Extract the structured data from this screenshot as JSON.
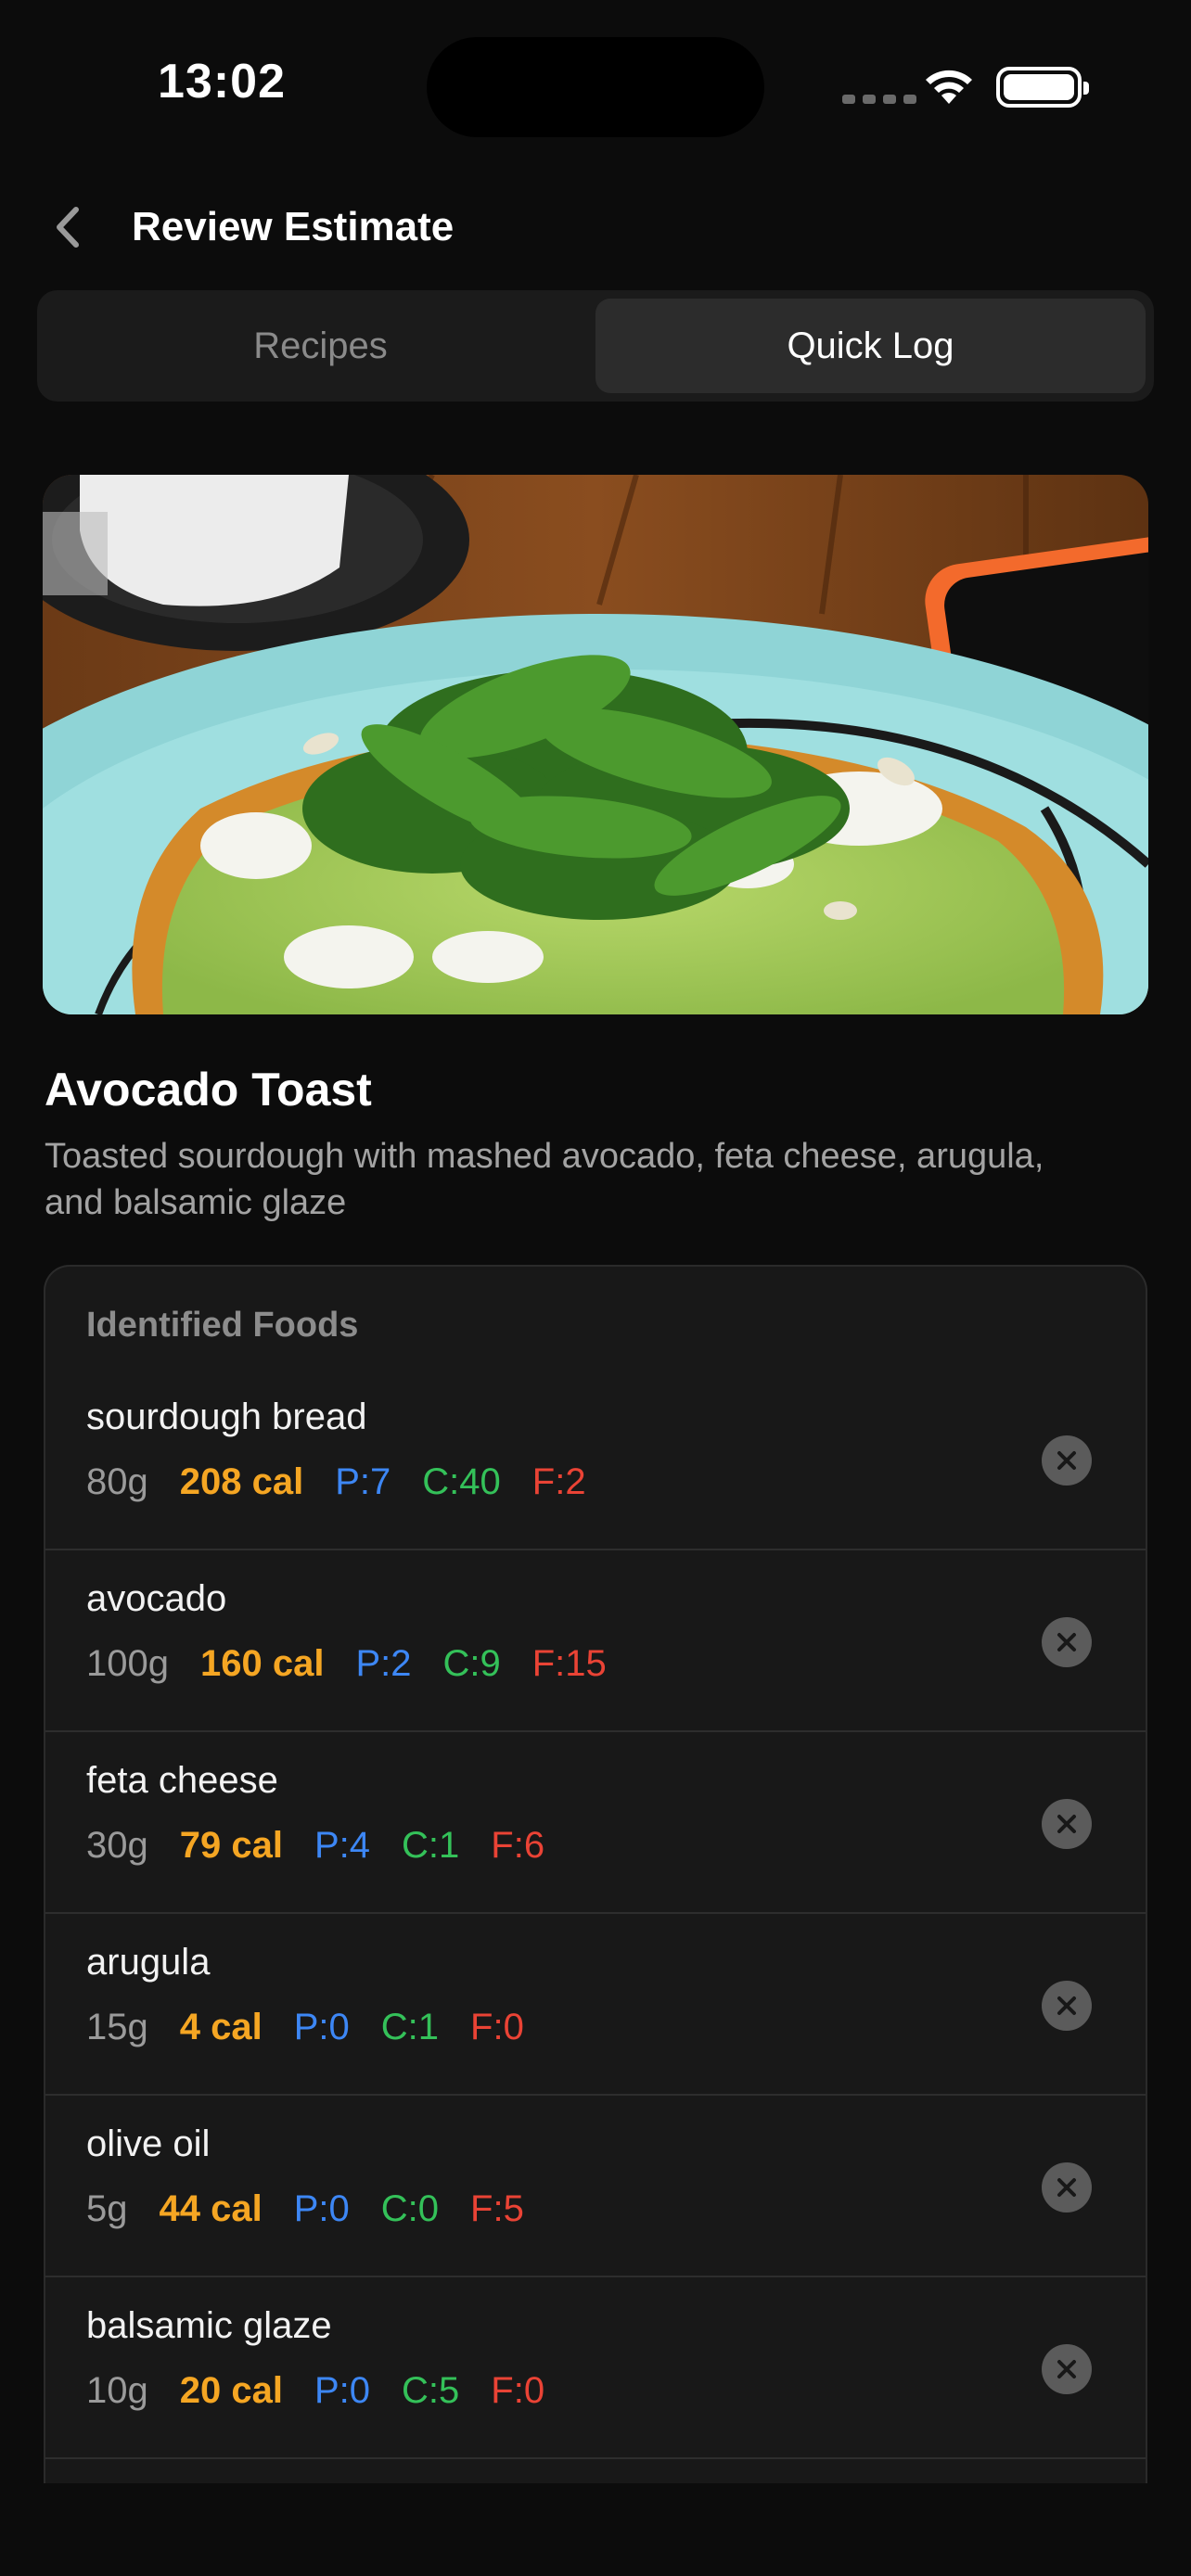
{
  "status_bar": {
    "time": "13:02"
  },
  "nav": {
    "title": "Review Estimate"
  },
  "tabs": [
    {
      "label": "Recipes",
      "active": false
    },
    {
      "label": "Quick Log",
      "active": true
    }
  ],
  "meal": {
    "title": "Avocado Toast",
    "description": "Toasted sourdough with mashed avocado, feta cheese, arugula, and balsamic glaze"
  },
  "foods_card": {
    "header": "Identified Foods",
    "items": [
      {
        "name": "sourdough bread",
        "grams": "80g",
        "calories": "208 cal",
        "protein": "P:7",
        "carbs": "C:40",
        "fat": "F:2"
      },
      {
        "name": "avocado",
        "grams": "100g",
        "calories": "160 cal",
        "protein": "P:2",
        "carbs": "C:9",
        "fat": "F:15"
      },
      {
        "name": "feta cheese",
        "grams": "30g",
        "calories": "79 cal",
        "protein": "P:4",
        "carbs": "C:1",
        "fat": "F:6"
      },
      {
        "name": "arugula",
        "grams": "15g",
        "calories": "4 cal",
        "protein": "P:0",
        "carbs": "C:1",
        "fat": "F:0"
      },
      {
        "name": "olive oil",
        "grams": "5g",
        "calories": "44 cal",
        "protein": "P:0",
        "carbs": "C:0",
        "fat": "F:5"
      },
      {
        "name": "balsamic glaze",
        "grams": "10g",
        "calories": "20 cal",
        "protein": "P:0",
        "carbs": "C:5",
        "fat": "F:0"
      }
    ]
  },
  "colors": {
    "background": "#0c0c0c",
    "card": "#181818",
    "calories": "#f5a623",
    "protein": "#3d87f5",
    "carbs": "#34c159",
    "fat": "#ea4335"
  },
  "icons": {
    "back": "chevron-left-icon",
    "remove": "close-circle-icon",
    "wifi": "wifi-icon",
    "battery": "battery-icon"
  }
}
